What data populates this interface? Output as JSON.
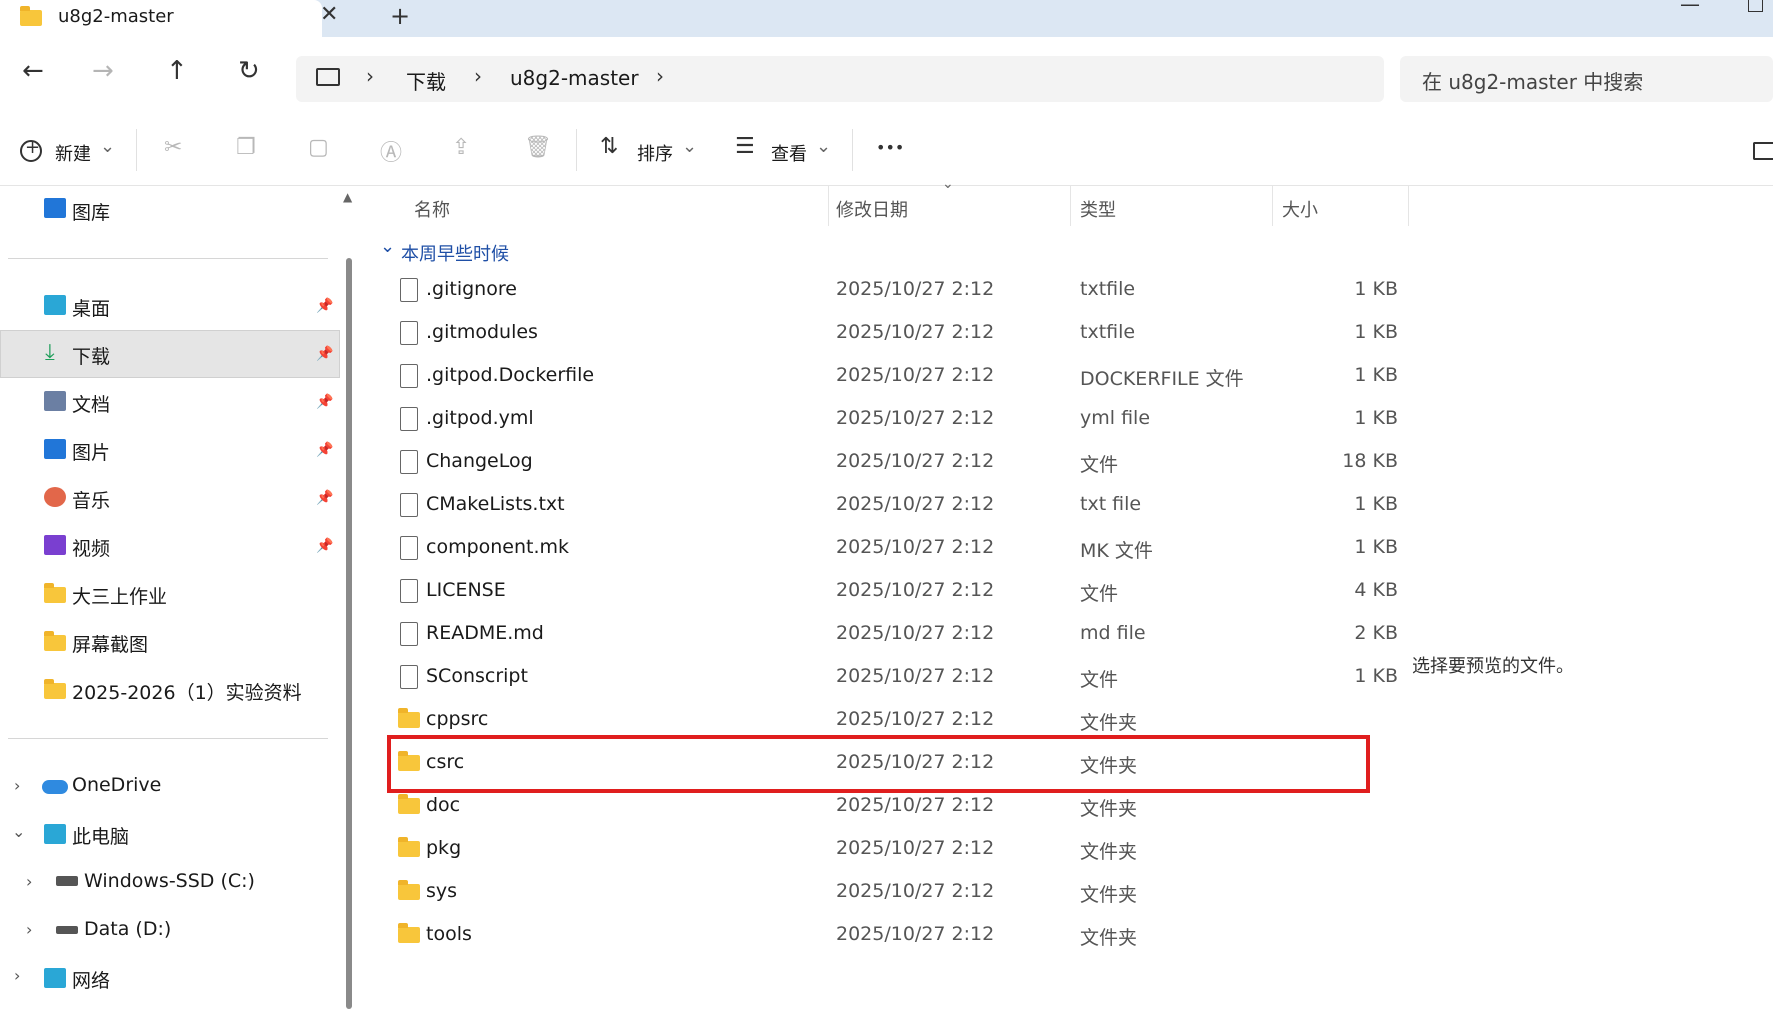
{
  "window": {
    "tab_title": "u8g2-master",
    "tab_close": "✕",
    "new_tab": "+",
    "minimize": "—"
  },
  "nav": {
    "back": "←",
    "forward": "→",
    "up": "↑",
    "refresh": "↻",
    "breadcrumb": [
      "下载",
      "u8g2-master"
    ],
    "chevron": "›",
    "search_placeholder": "在 u8g2-master 中搜索"
  },
  "toolbar": {
    "new_label": "新建",
    "sort_label": "排序",
    "view_label": "查看",
    "more": "•••",
    "dropdown": "⌄"
  },
  "sidebar": {
    "gallery": "图库",
    "pinned": [
      {
        "label": "桌面",
        "icon": "desktop-icon",
        "color": "#2aa7d6"
      },
      {
        "label": "下载",
        "icon": "download-icon",
        "color": "#1f9e5a",
        "selected": true
      },
      {
        "label": "文档",
        "icon": "document-icon",
        "color": "#6b7fa3"
      },
      {
        "label": "图片",
        "icon": "pictures-icon",
        "color": "#2176d8"
      },
      {
        "label": "音乐",
        "icon": "music-icon",
        "color": "#e2674a"
      },
      {
        "label": "视频",
        "icon": "video-icon",
        "color": "#7a3fd0"
      }
    ],
    "folders": [
      "大三上作业",
      "屏幕截图",
      "2025-2026（1）实验资料"
    ],
    "tree": [
      {
        "label": "OneDrive",
        "expander": "›"
      },
      {
        "label": "此电脑",
        "expander": "⌄"
      },
      {
        "label": "Windows-SSD (C:)",
        "expander": "›"
      },
      {
        "label": "Data (D:)",
        "expander": "›"
      },
      {
        "label": "网络",
        "expander": "›"
      }
    ]
  },
  "columns": {
    "name": "名称",
    "date": "修改日期",
    "type": "类型",
    "size": "大小"
  },
  "group_label": "本周早些时候",
  "group_chevron": "⌄",
  "files": [
    {
      "name": ".gitignore",
      "date": "2025/10/27 2:12",
      "type": "txtfile",
      "size": "1 KB",
      "kind": "file"
    },
    {
      "name": ".gitmodules",
      "date": "2025/10/27 2:12",
      "type": "txtfile",
      "size": "1 KB",
      "kind": "file"
    },
    {
      "name": ".gitpod.Dockerfile",
      "date": "2025/10/27 2:12",
      "type": "DOCKERFILE 文件",
      "size": "1 KB",
      "kind": "file"
    },
    {
      "name": ".gitpod.yml",
      "date": "2025/10/27 2:12",
      "type": "yml file",
      "size": "1 KB",
      "kind": "file"
    },
    {
      "name": "ChangeLog",
      "date": "2025/10/27 2:12",
      "type": "文件",
      "size": "18 KB",
      "kind": "file"
    },
    {
      "name": "CMakeLists.txt",
      "date": "2025/10/27 2:12",
      "type": "txt file",
      "size": "1 KB",
      "kind": "file"
    },
    {
      "name": "component.mk",
      "date": "2025/10/27 2:12",
      "type": "MK 文件",
      "size": "1 KB",
      "kind": "file"
    },
    {
      "name": "LICENSE",
      "date": "2025/10/27 2:12",
      "type": "文件",
      "size": "4 KB",
      "kind": "file"
    },
    {
      "name": "README.md",
      "date": "2025/10/27 2:12",
      "type": "md file",
      "size": "2 KB",
      "kind": "file"
    },
    {
      "name": "SConscript",
      "date": "2025/10/27 2:12",
      "type": "文件",
      "size": "1 KB",
      "kind": "file"
    },
    {
      "name": "cppsrc",
      "date": "2025/10/27 2:12",
      "type": "文件夹",
      "size": "",
      "kind": "folder"
    },
    {
      "name": "csrc",
      "date": "2025/10/27 2:12",
      "type": "文件夹",
      "size": "",
      "kind": "folder"
    },
    {
      "name": "doc",
      "date": "2025/10/27 2:12",
      "type": "文件夹",
      "size": "",
      "kind": "folder"
    },
    {
      "name": "pkg",
      "date": "2025/10/27 2:12",
      "type": "文件夹",
      "size": "",
      "kind": "folder"
    },
    {
      "name": "sys",
      "date": "2025/10/27 2:12",
      "type": "文件夹",
      "size": "",
      "kind": "folder"
    },
    {
      "name": "tools",
      "date": "2025/10/27 2:12",
      "type": "文件夹",
      "size": "",
      "kind": "folder"
    }
  ],
  "preview_text": "选择要预览的文件。",
  "colors": {
    "accent": "#1f4fa6",
    "highlight": "#e01e1e",
    "folder": "#f8c63b"
  }
}
